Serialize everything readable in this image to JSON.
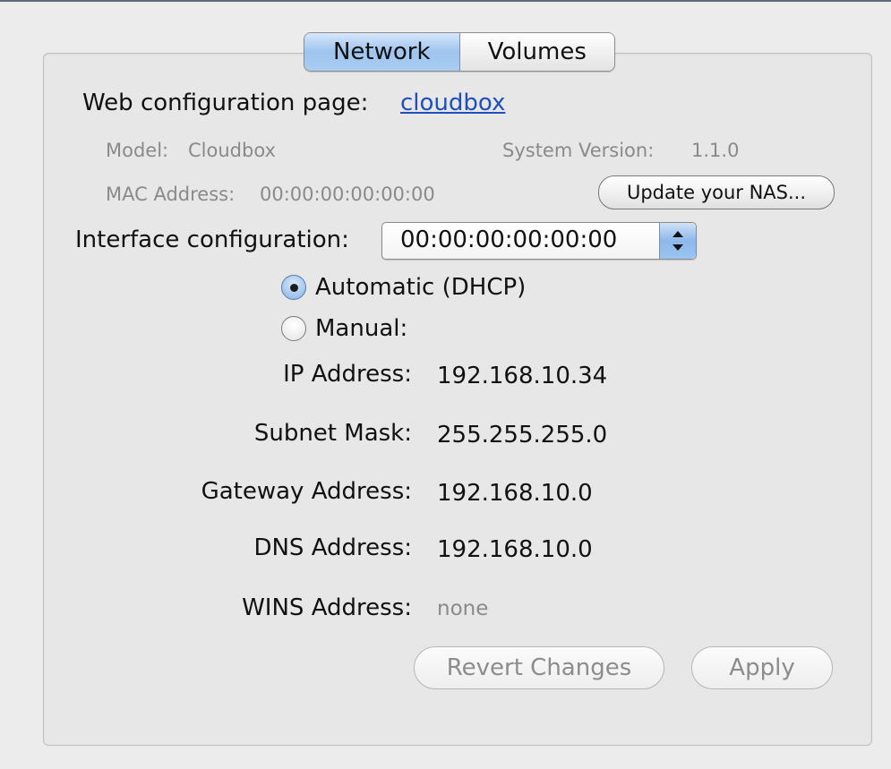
{
  "tabs": [
    {
      "label": "Network",
      "active": true
    },
    {
      "label": "Volumes",
      "active": false
    }
  ],
  "web_config": {
    "label": "Web configuration page:",
    "link": "cloudbox"
  },
  "info": {
    "model_label": "Model:",
    "model_value": "Cloudbox",
    "system_version_label": "System Version:",
    "system_version_value": "1.1.0",
    "mac_label": "MAC Address:",
    "mac_value": "00:00:00:00:00:00"
  },
  "update_button": "Update your NAS...",
  "interface": {
    "label": "Interface configuration:",
    "selected": "00:00:00:00:00:00"
  },
  "mode": {
    "automatic_label": "Automatic (DHCP)",
    "manual_label": "Manual:",
    "selected": "automatic"
  },
  "fields": [
    {
      "label": "IP Address:",
      "value": "192.168.10.34"
    },
    {
      "label": "Subnet Mask:",
      "value": "255.255.255.0"
    },
    {
      "label": "Gateway Address:",
      "value": "192.168.10.0"
    },
    {
      "label": "DNS Address:",
      "value": "192.168.10.0"
    },
    {
      "label": "WINS Address:",
      "value": "none"
    }
  ],
  "buttons": {
    "revert": "Revert Changes",
    "apply": "Apply"
  },
  "colors": {
    "link": "#1f4fbf",
    "selected_tab": "#a9cdf2"
  }
}
